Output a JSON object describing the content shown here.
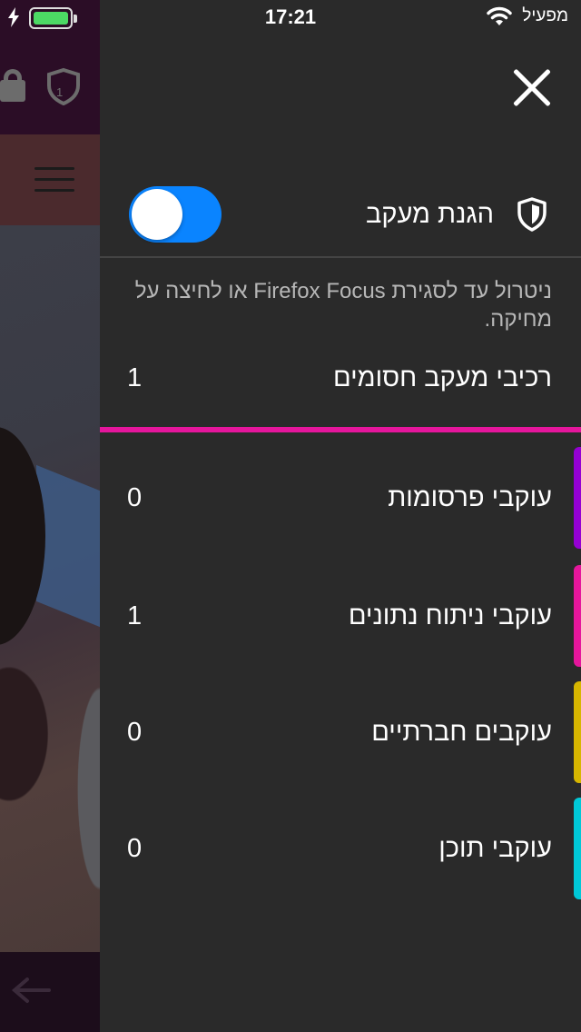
{
  "status_bar": {
    "time": "17:21",
    "carrier": "מפעיל",
    "battery_color": "#4cd964"
  },
  "panel": {
    "close_icon": "close-icon",
    "tracking_protection": {
      "label": "הגנת מעקב",
      "icon": "shield-icon",
      "enabled": true,
      "toggle_color": "#0a84ff"
    },
    "description": "ניטרול עד לסגירת Firefox Focus או לחיצה על מחיקה.",
    "blocked": {
      "label": "רכיבי מעקב חסומים",
      "count": "1",
      "accent_color": "#e5169c"
    },
    "categories": [
      {
        "label": "עוקבי פרסומות",
        "count": "0",
        "color": "#9400d3"
      },
      {
        "label": "עוקבי ניתוח נתונים",
        "count": "1",
        "color": "#e5169c"
      },
      {
        "label": "עוקבים חברתיים",
        "count": "0",
        "color": "#d7b600"
      },
      {
        "label": "עוקבי תוכן",
        "count": "0",
        "color": "#00c8d7"
      }
    ]
  },
  "background": {
    "tracker_badge_count": "1"
  }
}
